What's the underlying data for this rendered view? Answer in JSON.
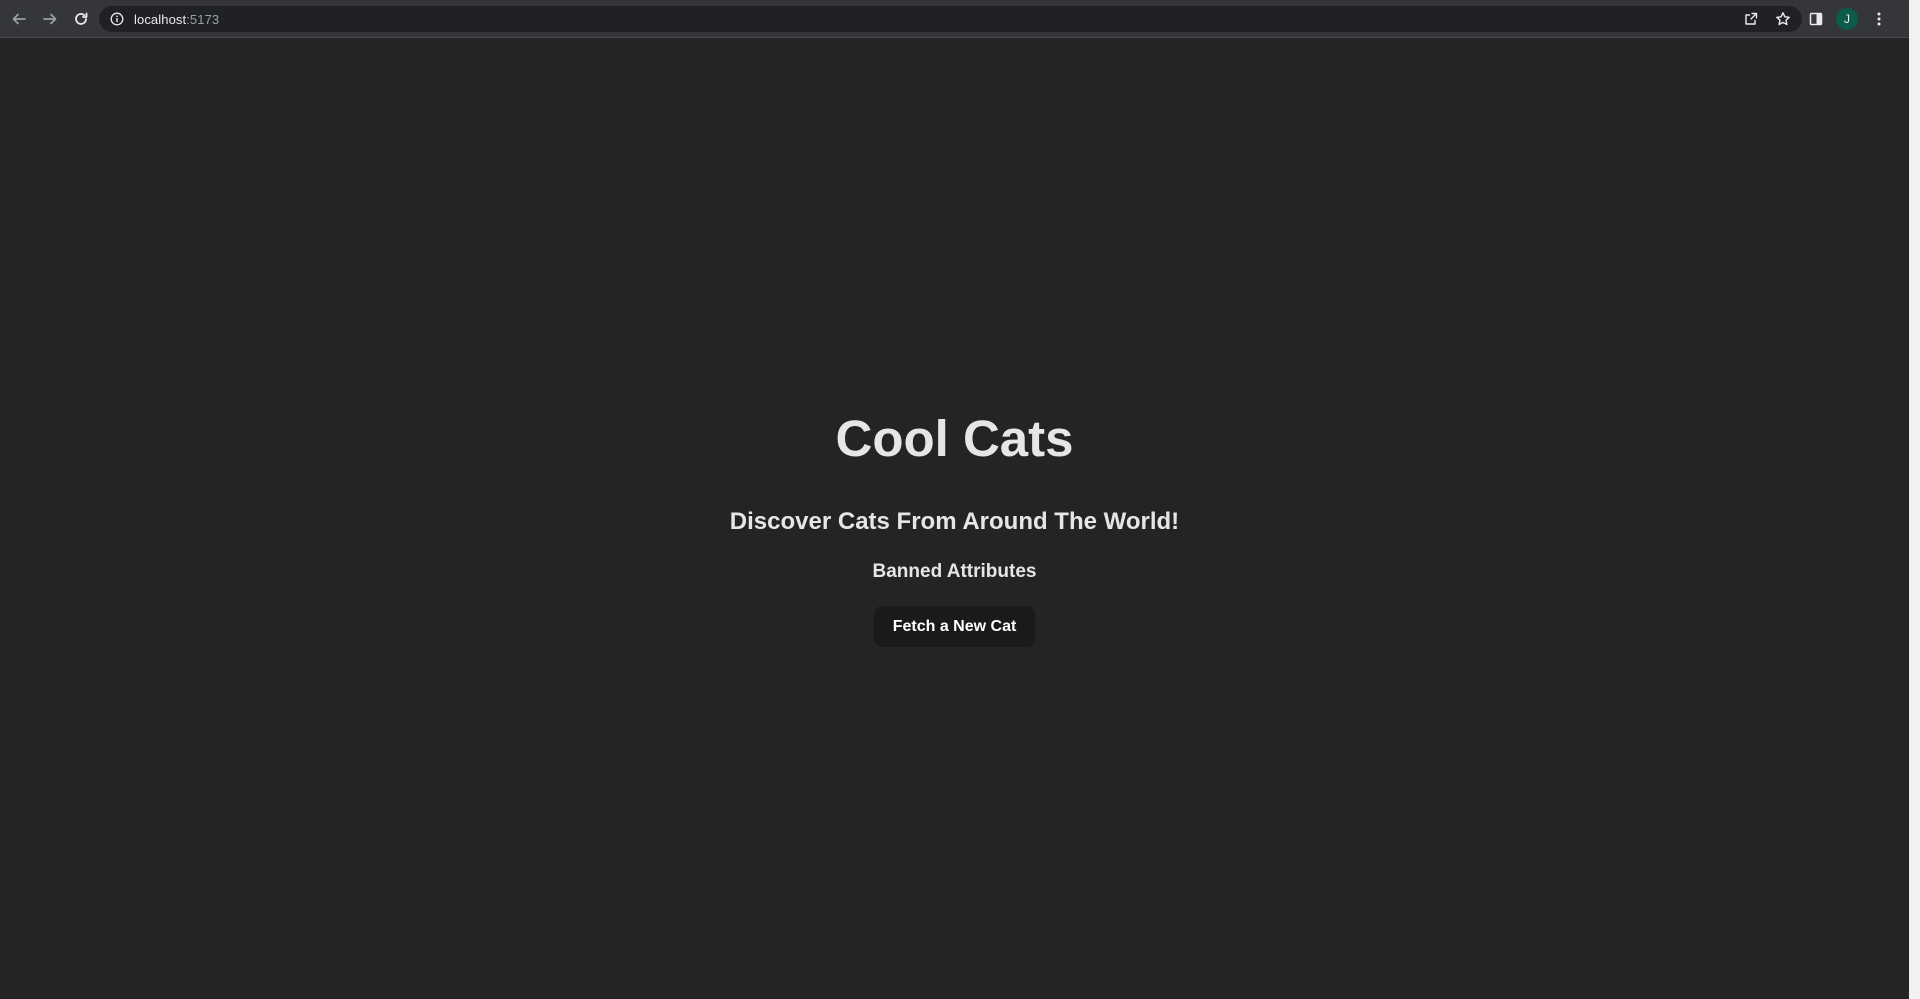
{
  "browser": {
    "url_host": "localhost",
    "url_port": ":5173",
    "profile_initial": "J"
  },
  "main": {
    "title": "Cool Cats",
    "subtitle": "Discover Cats From Around The World!",
    "banned_heading": "Banned Attributes",
    "fetch_button_label": "Fetch a New Cat"
  },
  "icons": {
    "back": "back-arrow-icon",
    "forward": "forward-arrow-icon",
    "reload": "reload-icon",
    "site_info": "info-icon",
    "share": "share-icon",
    "bookmark": "star-icon",
    "side_panel": "side-panel-icon",
    "menu": "more-vertical-icon"
  },
  "colors": {
    "page_background": "#242424",
    "heading_text": "#e6e6e6",
    "button_background": "#1a1a1a",
    "avatar_background": "#0d5b4a"
  }
}
